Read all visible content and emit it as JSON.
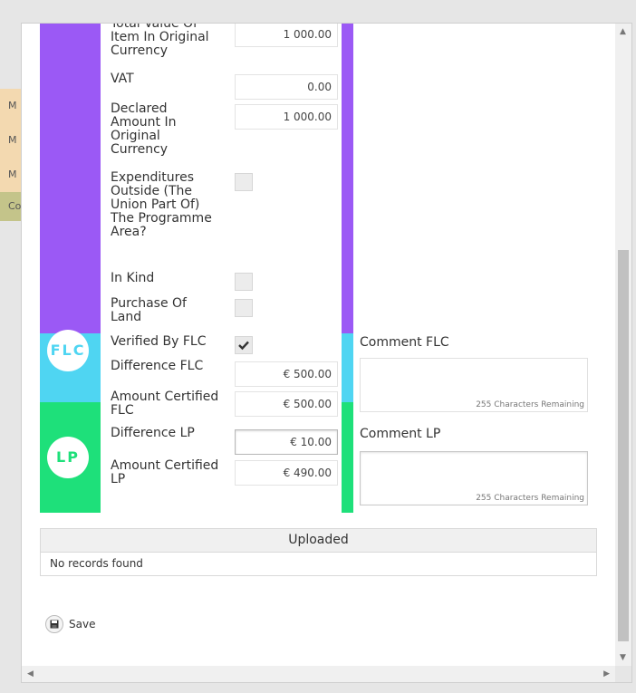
{
  "background_tabs": [
    "M",
    "M",
    "M",
    "Co"
  ],
  "form": {
    "total_value_label": "Total Value Of Item In Original Currency",
    "total_value": "1 000.00",
    "vat_label": "VAT",
    "vat": "0.00",
    "declared_label": "Declared Amount In Original Currency",
    "declared": "1 000.00",
    "expenditures_label": "Expenditures Outside (The Union Part Of) The Programme Area?",
    "in_kind_label": "In Kind",
    "purchase_label": "Purchase Of Land",
    "verified_label": "Verified By FLC",
    "difference_flc_label": "Difference FLC",
    "difference_flc": "€ 500.00",
    "amount_flc_label": "Amount Certified FLC",
    "amount_flc": "€ 500.00",
    "difference_lp_label": "Difference LP",
    "difference_lp": "€ 10.00",
    "amount_lp_label": "Amount Certified LP",
    "amount_lp": "€ 490.00"
  },
  "badges": {
    "flc": "FLC",
    "lp": "LP"
  },
  "comments": {
    "flc_title": "Comment FLC",
    "lp_title": "Comment LP",
    "remaining": "255 Characters Remaining"
  },
  "uploaded": {
    "title": "Uploaded",
    "empty": "No records found"
  },
  "actions": {
    "save": "Save"
  },
  "colors": {
    "purple": "#9b59f5",
    "cyan": "#4fd5f2",
    "green": "#1ee07a"
  }
}
